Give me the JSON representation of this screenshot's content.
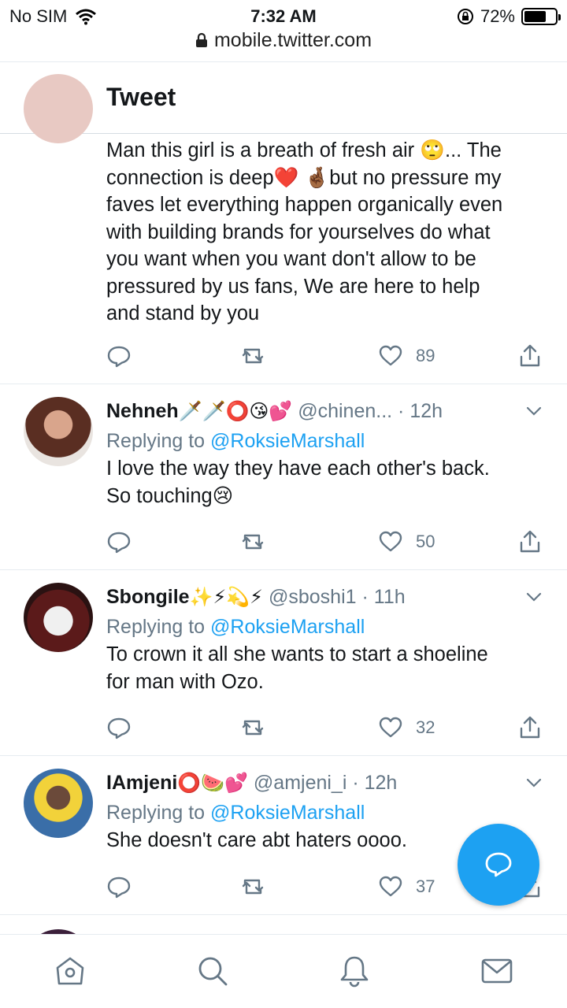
{
  "status_bar": {
    "carrier": "No SIM",
    "time": "7:32 AM",
    "battery": "72%",
    "battery_level": 0.72
  },
  "browser": {
    "url": "mobile.twitter.com"
  },
  "header": {
    "title": "Tweet"
  },
  "colors": {
    "accent": "#1da1f2",
    "muted": "#657786",
    "text": "#14171a",
    "divider": "#e6ecf0"
  },
  "main_tweet": {
    "text_lines": [
      "Man this girl is a breath of fresh air 🙄... The",
      "connection is deep❤️ 🤞🏾but no pressure my",
      "faves let everything happen organically even",
      "with building brands for yourselves do what",
      "you want when you want don't allow to be",
      "pressured by us fans, We are here to help",
      "and stand by you"
    ],
    "likes": "89"
  },
  "replies": [
    {
      "name": "Nehneh",
      "name_emoji": "🗡️🗡️⭕😘💕",
      "handle": "@chinen...",
      "age": "12h",
      "replying_prefix": "Replying to ",
      "replying_to": "@RoksieMarshall",
      "text_lines": [
        "I love the way they have each other's back.",
        "So touching😢"
      ],
      "likes": "50"
    },
    {
      "name": "Sbongile",
      "name_emoji": "✨⚡💫⚡",
      "handle": "@sboshi1",
      "age": "11h",
      "replying_prefix": "Replying to ",
      "replying_to": "@RoksieMarshall",
      "text_lines": [
        "To crown it all she wants to start a shoeline",
        "for man with Ozo."
      ],
      "likes": "32"
    },
    {
      "name": "IAmjeni",
      "name_emoji": "⭕🍉💕",
      "handle": "@amjeni_i",
      "age": "12h",
      "replying_prefix": "Replying to ",
      "replying_to": "@RoksieMarshall",
      "text_lines": [
        "She doesn't care abt haters oooo."
      ],
      "likes": "37"
    }
  ],
  "separator": "·",
  "icons": {
    "back": "arrow-left-icon",
    "reply": "comment-icon",
    "retweet": "retweet-icon",
    "like": "heart-icon",
    "share": "share-icon",
    "more": "chevron-down-icon",
    "compose": "compose-reply-icon",
    "tabs": [
      "home-icon",
      "search-icon",
      "notifications-icon",
      "messages-icon"
    ]
  }
}
